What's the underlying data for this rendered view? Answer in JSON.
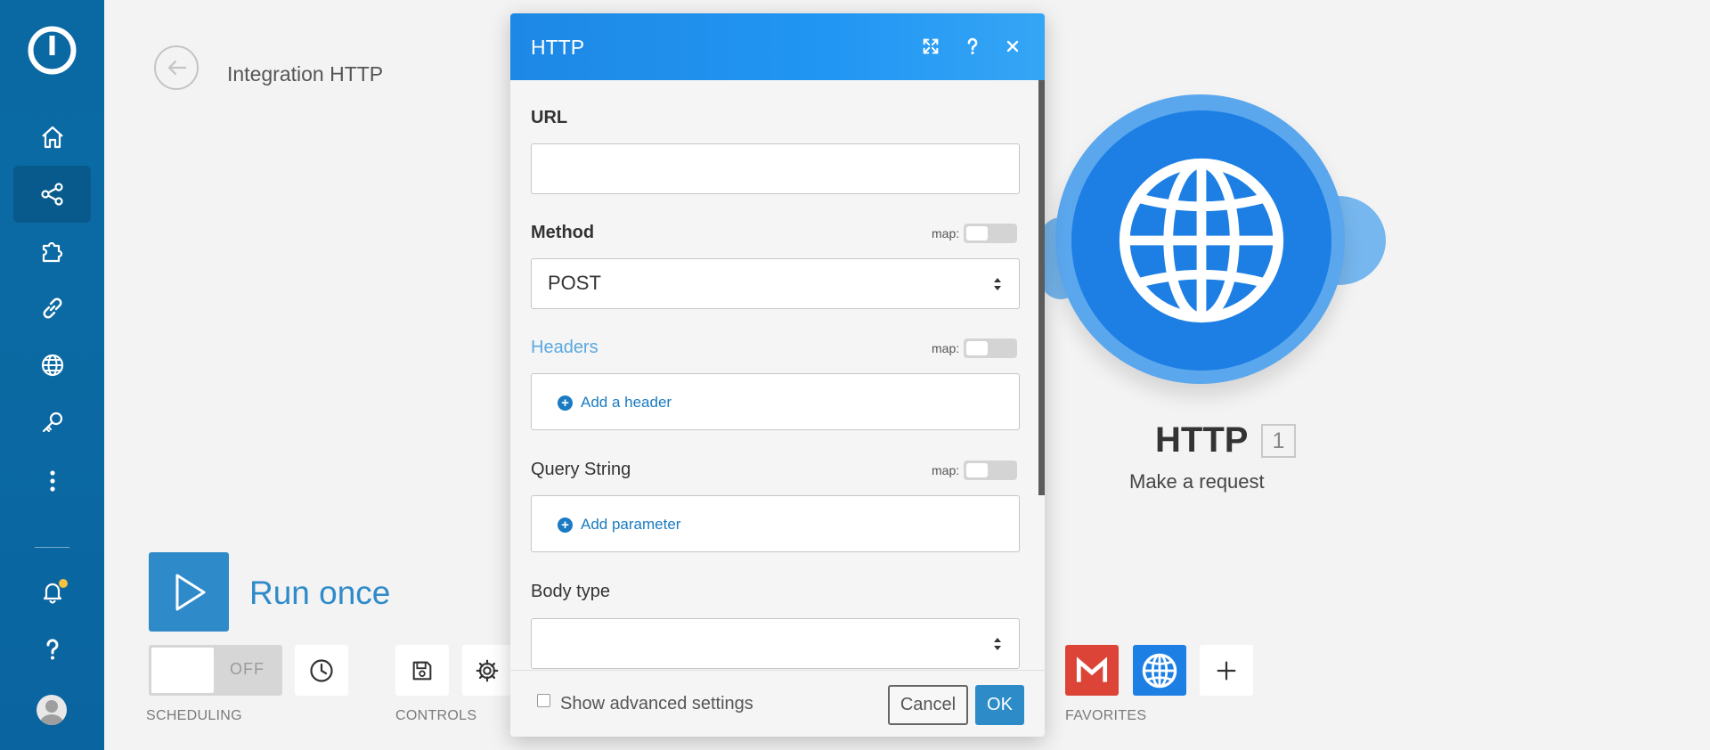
{
  "scenario": {
    "title": "Integration HTTP"
  },
  "sidebar": {
    "items": [
      {
        "name": "home",
        "icon": "home-icon"
      },
      {
        "name": "scenarios",
        "icon": "share-icon",
        "active": true
      },
      {
        "name": "templates",
        "icon": "puzzle-icon"
      },
      {
        "name": "connections",
        "icon": "link-icon"
      },
      {
        "name": "webhooks",
        "icon": "globe-icon"
      },
      {
        "name": "keys",
        "icon": "key-icon"
      },
      {
        "name": "more",
        "icon": "more-vertical-icon"
      },
      {
        "name": "notifications",
        "icon": "bell-icon"
      },
      {
        "name": "help",
        "icon": "question-icon"
      },
      {
        "name": "profile",
        "icon": "avatar-icon"
      }
    ]
  },
  "module": {
    "title": "HTTP",
    "badge": "1",
    "subtitle": "Make a request",
    "color": "#1d7fe4"
  },
  "run": {
    "label": "Run once"
  },
  "toolbar": {
    "scheduling_toggle": "OFF",
    "scheduling_label": "SCHEDULING",
    "controls_label": "CONTROLS",
    "favorites_label": "FAVORITES"
  },
  "dialog": {
    "title": "HTTP",
    "url_label": "URL",
    "url_value": "",
    "method_label": "Method",
    "method_value": "POST",
    "map_label": "map:",
    "headers_label": "Headers",
    "add_header": "Add a header",
    "query_label": "Query String",
    "add_parameter": "Add parameter",
    "body_type_label": "Body type",
    "body_type_value": "",
    "advanced_label": "Show advanced settings",
    "cancel": "Cancel",
    "ok": "OK"
  },
  "colors": {
    "sidebar": "#0a69a3",
    "accent": "#2f8ac9",
    "dialog_header": "#1e88e5",
    "gmail": "#db4437"
  }
}
